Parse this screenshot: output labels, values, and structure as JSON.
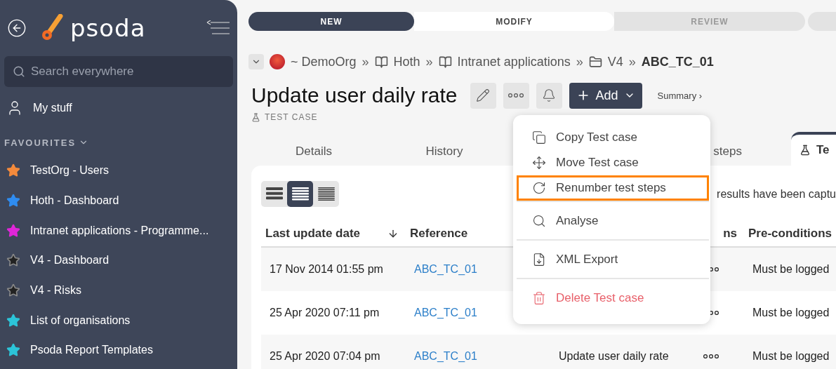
{
  "sidebar": {
    "logo": "psoda",
    "search": {
      "placeholder": "Search everywhere"
    },
    "my_stuff": "My stuff",
    "favourites_heading": "FAVOURITES",
    "favourites": [
      {
        "label": "TestOrg - Users",
        "color": "#f38a3c"
      },
      {
        "label": "Hoth - Dashboard",
        "color": "#2f8cf0"
      },
      {
        "label": "Intranet applications - Programme...",
        "color": "#e026d8"
      },
      {
        "label": "V4 - Dashboard",
        "color": "#222222"
      },
      {
        "label": "V4 - Risks",
        "color": "#222222"
      },
      {
        "label": "List of organisations",
        "color": "#2cc4d8"
      },
      {
        "label": "Psoda Report Templates",
        "color": "#2cc4d8"
      }
    ]
  },
  "workflow": [
    {
      "label": "NEW",
      "kind": "done"
    },
    {
      "label": "MODIFY",
      "kind": "current"
    },
    {
      "label": "REVIEW",
      "kind": "pending"
    }
  ],
  "breadcrumb": [
    {
      "label": "~ DemoOrg",
      "kind": "org"
    },
    {
      "separator": "»",
      "label": "Hoth",
      "kind": "book"
    },
    {
      "separator": "»",
      "label": "Intranet applications",
      "kind": "book"
    },
    {
      "separator": "»",
      "label": "V4",
      "kind": "folder"
    },
    {
      "separator": "»",
      "label": "ABC_TC_01",
      "kind": "current"
    }
  ],
  "title": "Update user daily rate",
  "subtitle": "TEST CASE",
  "add_button": "Add",
  "summary_link": "Summary ›",
  "tabs": [
    {
      "label": "Details",
      "selected": false
    },
    {
      "label": "History",
      "selected": false
    },
    {
      "label": "steps",
      "selected": false
    },
    {
      "label": "Te",
      "selected": true
    }
  ],
  "view_modes": [
    {
      "kind": "comfortable",
      "selected": false
    },
    {
      "kind": "normal",
      "selected": true
    },
    {
      "kind": "compact",
      "selected": false
    }
  ],
  "notice": "results have been captu",
  "table": {
    "columns": [
      "Last update date",
      "Reference",
      "",
      "ns",
      "Pre-conditions"
    ],
    "rows": [
      {
        "date": "17 Nov 2014 01:55 pm",
        "reference": "ABC_TC_01",
        "precondition": "Must be logged"
      },
      {
        "date": "25 Apr 2020 07:11 pm",
        "reference": "ABC_TC_01",
        "precondition": "Must be logged"
      },
      {
        "date": "25 Apr 2020 07:04 pm",
        "reference": "ABC_TC_01",
        "name": "Update user daily rate",
        "precondition": "Must be logged"
      }
    ]
  },
  "menu": [
    {
      "label": "Copy Test case",
      "kind": "copy",
      "highlighted": false
    },
    {
      "label": "Move Test case",
      "kind": "move",
      "highlighted": false
    },
    {
      "label": "Renumber test steps",
      "kind": "renumber",
      "highlighted": true
    },
    {
      "label": "Analyse",
      "kind": "analyse",
      "highlighted": false
    },
    {
      "label": "XML Export",
      "kind": "export",
      "highlighted": false
    },
    {
      "label": "Delete Test case",
      "kind": "delete",
      "highlighted": false
    }
  ]
}
